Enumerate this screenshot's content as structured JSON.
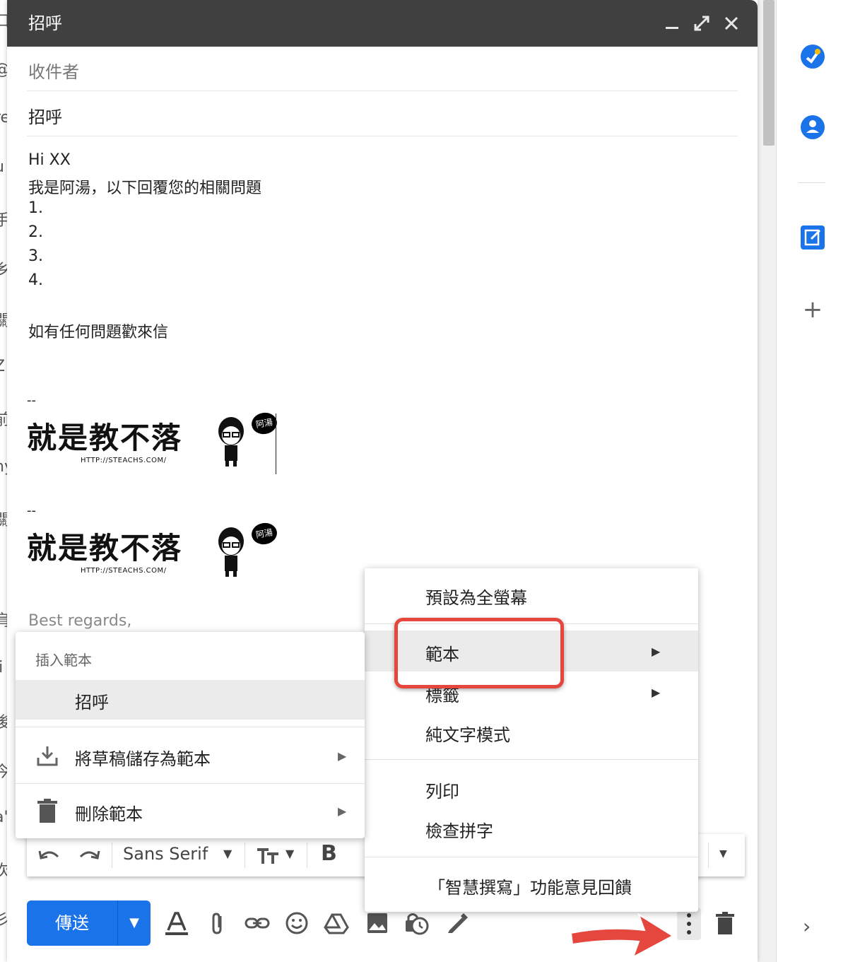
{
  "compose": {
    "title": "招呼",
    "to_label": "收件者",
    "subject": "招呼",
    "body_lines": [
      "Hi XX",
      "我是阿湯，以下回覆您的相關問題",
      "1.",
      "2.",
      "3.",
      "4.",
      "如有任何問題歡來信"
    ],
    "sig_dash": "--",
    "sig_text": "就是教不落",
    "sig_url": "HTTP://STEACHS.COM/",
    "sig_bubble": "阿湯",
    "closing": "Best regards,"
  },
  "toolbar": {
    "send_label": "傳送",
    "font_name": "Sans Serif",
    "bold": "B"
  },
  "more_menu": {
    "items": [
      "預設為全螢幕",
      "範本",
      "標籤",
      "純文字模式",
      "列印",
      "檢查拼字",
      "「智慧撰寫」功能意見回饋"
    ]
  },
  "template_menu": {
    "header": "插入範本",
    "template_item": "招呼",
    "save_draft": "將草稿儲存為範本",
    "delete": "刪除範本"
  },
  "colors": {
    "accent": "#1a73e8",
    "highlight": "#e5463d",
    "titlebar": "#404040"
  }
}
